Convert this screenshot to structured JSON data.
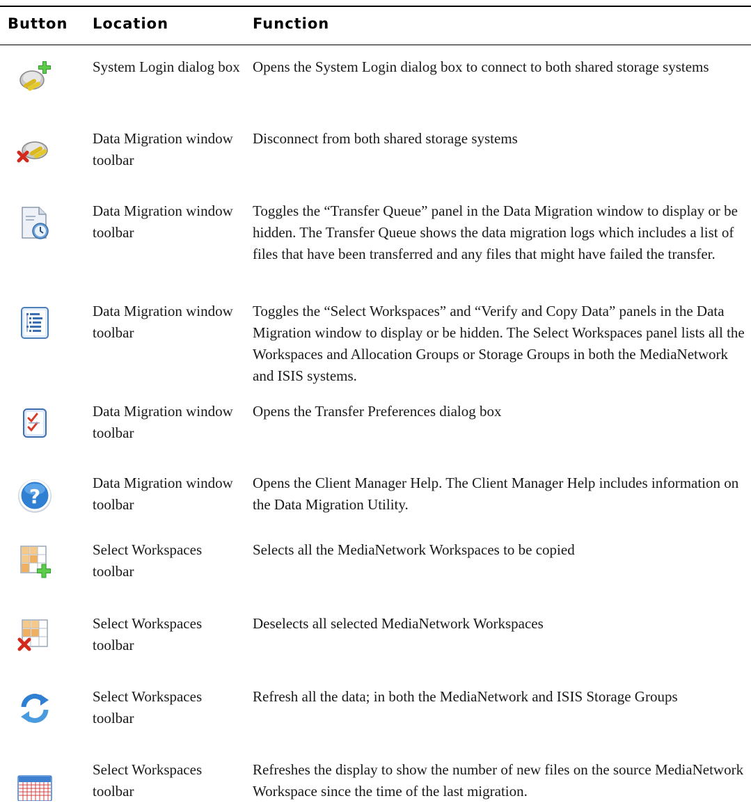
{
  "table": {
    "headers": {
      "button": "Button",
      "location": "Location",
      "function": "Function"
    },
    "rows": [
      {
        "icon": "system-login-icon",
        "location": "System Login dialog box",
        "function": "Opens the System Login dialog box to connect to both shared storage systems"
      },
      {
        "icon": "disconnect-icon",
        "location": "Data Migration window toolbar",
        "function": "Disconnect from both shared storage systems"
      },
      {
        "icon": "transfer-queue-icon",
        "location": "Data Migration window toolbar",
        "function": "Toggles the “Transfer Queue” panel in the Data Migration window to display or be hidden. The Transfer Queue shows the data migration logs which includes a list of files that have been transferred and any files that might have failed the transfer."
      },
      {
        "icon": "select-workspaces-panel-icon",
        "location": "Data Migration window toolbar",
        "function": "Toggles the “Select Workspaces” and “Verify and Copy Data” panels in the Data Migration window to display or be hidden. The Select Workspaces panel lists all the Workspaces and Allocation Groups or Storage Groups in both the MediaNetwork and ISIS systems."
      },
      {
        "icon": "transfer-preferences-icon",
        "location": "Data Migration window toolbar",
        "function": "Opens the Transfer Preferences dialog box"
      },
      {
        "icon": "help-icon",
        "location": "Data Migration window toolbar",
        "function": "Opens the Client Manager Help. The Client Manager Help includes information on the Data Migration Utility."
      },
      {
        "icon": "select-all-workspaces-icon",
        "location": "Select Workspaces toolbar",
        "function": "Selects all the MediaNetwork Workspaces to be copied"
      },
      {
        "icon": "deselect-workspaces-icon",
        "location": "Select Workspaces toolbar",
        "function": "Deselects all selected MediaNetwork Workspaces"
      },
      {
        "icon": "refresh-icon",
        "location": "Select Workspaces toolbar",
        "function": "Refresh all the data; in both the MediaNetwork and ISIS Storage Groups"
      },
      {
        "icon": "refresh-display-icon",
        "location": "Select Workspaces toolbar",
        "function": "Refreshes the display to show the number of new files on the source MediaNetwork Workspace since the time of the last migration."
      }
    ]
  }
}
